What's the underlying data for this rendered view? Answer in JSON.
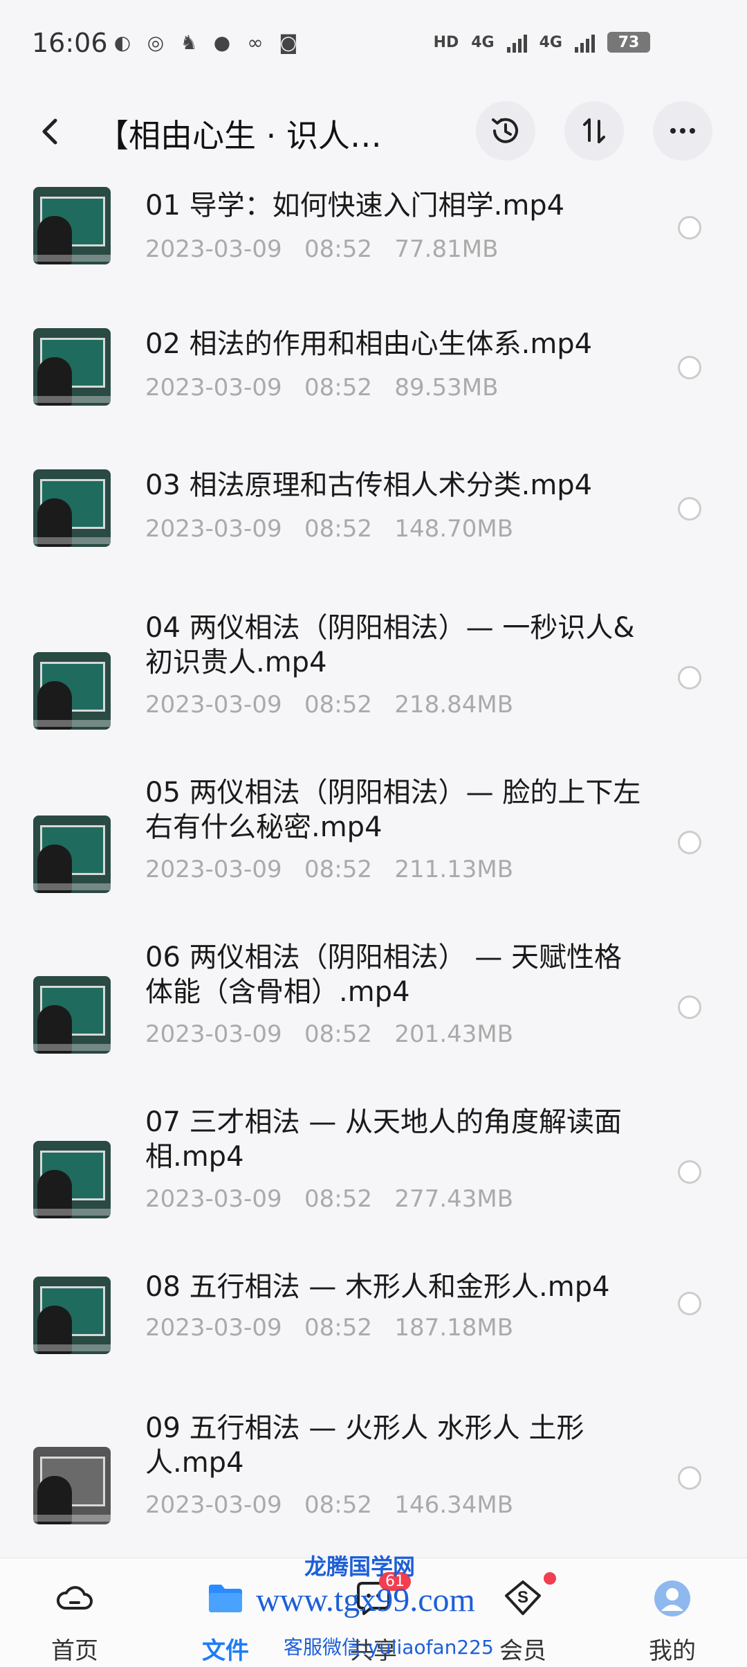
{
  "status_bar": {
    "time": "16:06",
    "network_1": "4G",
    "network_2": "4G",
    "hd": "HD",
    "battery": "73"
  },
  "header": {
    "title": "【相由心生 · 识人…"
  },
  "files": [
    {
      "name": "01 导学：如何快速入门相学.mp4",
      "meta": "2023-03-09   08:52   77.81MB"
    },
    {
      "name": "02 相法的作用和相由心生体系.mp4",
      "meta": "2023-03-09   08:52   89.53MB"
    },
    {
      "name": "03 相法原理和古传相人术分类.mp4",
      "meta": "2023-03-09   08:52   148.70MB"
    },
    {
      "name": "04 两仪相法（阴阳相法）—  一秒识人& 初识贵人.mp4",
      "meta": "2023-03-09   08:52   218.84MB"
    },
    {
      "name": "05 两仪相法（阴阳相法）—  脸的上下左右有什么秘密.mp4",
      "meta": "2023-03-09   08:52   211.13MB"
    },
    {
      "name": "06 两仪相法（阴阳相法） — 天赋性格体能（含骨相）.mp4",
      "meta": "2023-03-09   08:52   201.43MB"
    },
    {
      "name": "07 三才相法  — 从天地人的角度解读面相.mp4",
      "meta": "2023-03-09   08:52   277.43MB"
    },
    {
      "name": "08 五行相法 — 木形人和金形人.mp4",
      "meta": "2023-03-09   08:52   187.18MB"
    },
    {
      "name": "09 五行相法 — 火形人 水形人 土形人.mp4",
      "meta": "2023-03-09   08:52   146.34MB"
    }
  ],
  "nav": {
    "home": "首页",
    "files": "文件",
    "share": "共享",
    "share_badge": "61",
    "vip": "会员",
    "mine": "我的"
  },
  "watermark": {
    "site_name": "龙腾国学网",
    "url": "www.tgx99.com",
    "contact": "客服微信:yuliaofan225"
  },
  "colors": {
    "accent": "#1e7cf5",
    "badge": "#f23e4f",
    "watermark": "#1d5fd6"
  }
}
